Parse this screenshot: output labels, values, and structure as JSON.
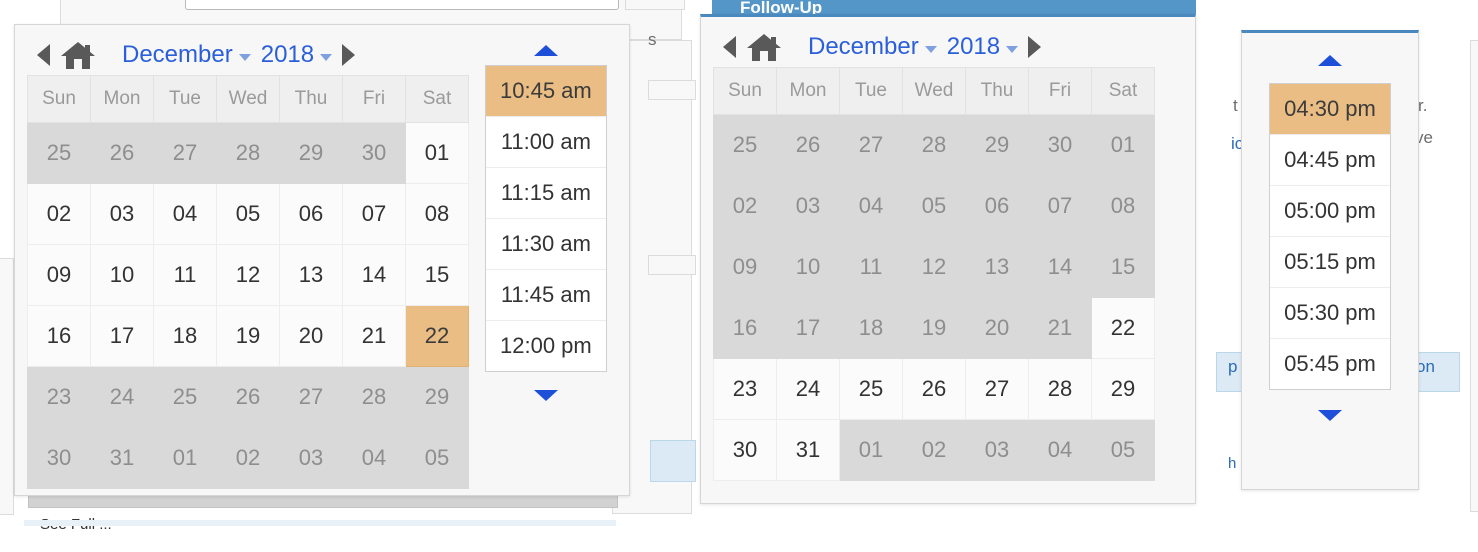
{
  "colors": {
    "selected_amber": "#e9bd83",
    "disabled_grey": "#d9d9d9",
    "link_blue": "#2b5fd9",
    "arrow_blue": "#1e4fd8",
    "accent_blue": "#4a89bd",
    "panel_bg": "#f7f7f7"
  },
  "weekdays": [
    "Sun",
    "Mon",
    "Tue",
    "Wed",
    "Thu",
    "Fri",
    "Sat"
  ],
  "background": {
    "cut_window_title": "Follow-Up",
    "fragment_texts": {
      "left_edge": "s",
      "right_1": "t",
      "right_2": "r.",
      "right_3": "ic",
      "right_4": "ve",
      "blue_left": "p",
      "blue_right": "on",
      "bottom_small": "h",
      "bottom_cut": "See Full ..."
    }
  },
  "picker_one": {
    "name": "start-datetime-picker",
    "header": {
      "prev_label": "previous-month",
      "home_label": "today",
      "month": "December",
      "year": "2018",
      "next_label": "next-month"
    },
    "selected_day": "22",
    "weeks": [
      [
        {
          "d": "25",
          "s": "dim"
        },
        {
          "d": "26",
          "s": "dim"
        },
        {
          "d": "27",
          "s": "dim"
        },
        {
          "d": "28",
          "s": "dim"
        },
        {
          "d": "29",
          "s": "dim"
        },
        {
          "d": "30",
          "s": "dim"
        },
        {
          "d": "01",
          "s": "on"
        }
      ],
      [
        {
          "d": "02",
          "s": "on"
        },
        {
          "d": "03",
          "s": "on"
        },
        {
          "d": "04",
          "s": "on"
        },
        {
          "d": "05",
          "s": "on"
        },
        {
          "d": "06",
          "s": "on"
        },
        {
          "d": "07",
          "s": "on"
        },
        {
          "d": "08",
          "s": "on"
        }
      ],
      [
        {
          "d": "09",
          "s": "on"
        },
        {
          "d": "10",
          "s": "on"
        },
        {
          "d": "11",
          "s": "on"
        },
        {
          "d": "12",
          "s": "on"
        },
        {
          "d": "13",
          "s": "on"
        },
        {
          "d": "14",
          "s": "on"
        },
        {
          "d": "15",
          "s": "on"
        }
      ],
      [
        {
          "d": "16",
          "s": "on"
        },
        {
          "d": "17",
          "s": "on"
        },
        {
          "d": "18",
          "s": "on"
        },
        {
          "d": "19",
          "s": "on"
        },
        {
          "d": "20",
          "s": "on"
        },
        {
          "d": "21",
          "s": "on"
        },
        {
          "d": "22",
          "s": "sel"
        }
      ],
      [
        {
          "d": "23",
          "s": "dim"
        },
        {
          "d": "24",
          "s": "dim"
        },
        {
          "d": "25",
          "s": "dim"
        },
        {
          "d": "26",
          "s": "dim"
        },
        {
          "d": "27",
          "s": "dim"
        },
        {
          "d": "28",
          "s": "dim"
        },
        {
          "d": "29",
          "s": "dim"
        }
      ],
      [
        {
          "d": "30",
          "s": "dim"
        },
        {
          "d": "31",
          "s": "dim"
        },
        {
          "d": "01",
          "s": "dim"
        },
        {
          "d": "02",
          "s": "dim"
        },
        {
          "d": "03",
          "s": "dim"
        },
        {
          "d": "04",
          "s": "dim"
        },
        {
          "d": "05",
          "s": "dim"
        }
      ]
    ],
    "times": {
      "selected": "10:45 am",
      "items": [
        {
          "t": "10:45 am",
          "s": "sel"
        },
        {
          "t": "11:00 am",
          "s": "on"
        },
        {
          "t": "11:15 am",
          "s": "on"
        },
        {
          "t": "11:30 am",
          "s": "on"
        },
        {
          "t": "11:45 am",
          "s": "on"
        },
        {
          "t": "12:00 pm",
          "s": "on"
        }
      ]
    }
  },
  "picker_two": {
    "name": "end-date-picker",
    "header": {
      "prev_label": "previous-month",
      "home_label": "today",
      "month": "December",
      "year": "2018",
      "next_label": "next-month"
    },
    "selected_day": "22",
    "weeks": [
      [
        {
          "d": "25",
          "s": "dim"
        },
        {
          "d": "26",
          "s": "dim"
        },
        {
          "d": "27",
          "s": "dim"
        },
        {
          "d": "28",
          "s": "dim"
        },
        {
          "d": "29",
          "s": "dim"
        },
        {
          "d": "30",
          "s": "dim"
        },
        {
          "d": "01",
          "s": "dim"
        }
      ],
      [
        {
          "d": "02",
          "s": "dim"
        },
        {
          "d": "03",
          "s": "dim"
        },
        {
          "d": "04",
          "s": "dim"
        },
        {
          "d": "05",
          "s": "dim"
        },
        {
          "d": "06",
          "s": "dim"
        },
        {
          "d": "07",
          "s": "dim"
        },
        {
          "d": "08",
          "s": "dim"
        }
      ],
      [
        {
          "d": "09",
          "s": "dim"
        },
        {
          "d": "10",
          "s": "dim"
        },
        {
          "d": "11",
          "s": "dim"
        },
        {
          "d": "12",
          "s": "dim"
        },
        {
          "d": "13",
          "s": "dim"
        },
        {
          "d": "14",
          "s": "dim"
        },
        {
          "d": "15",
          "s": "dim"
        }
      ],
      [
        {
          "d": "16",
          "s": "dim"
        },
        {
          "d": "17",
          "s": "dim"
        },
        {
          "d": "18",
          "s": "dim"
        },
        {
          "d": "19",
          "s": "dim"
        },
        {
          "d": "20",
          "s": "dim"
        },
        {
          "d": "21",
          "s": "dim"
        },
        {
          "d": "22",
          "s": "on"
        }
      ],
      [
        {
          "d": "23",
          "s": "on"
        },
        {
          "d": "24",
          "s": "on"
        },
        {
          "d": "25",
          "s": "on"
        },
        {
          "d": "26",
          "s": "on"
        },
        {
          "d": "27",
          "s": "on"
        },
        {
          "d": "28",
          "s": "on"
        },
        {
          "d": "29",
          "s": "on"
        }
      ],
      [
        {
          "d": "30",
          "s": "on"
        },
        {
          "d": "31",
          "s": "on"
        },
        {
          "d": "01",
          "s": "dim"
        },
        {
          "d": "02",
          "s": "dim"
        },
        {
          "d": "03",
          "s": "dim"
        },
        {
          "d": "04",
          "s": "dim"
        },
        {
          "d": "05",
          "s": "dim"
        }
      ]
    ]
  },
  "picker_three": {
    "name": "end-time-picker",
    "times": {
      "selected": "04:30 pm",
      "items": [
        {
          "t": "04:30 pm",
          "s": "sel"
        },
        {
          "t": "04:45 pm",
          "s": "on"
        },
        {
          "t": "05:00 pm",
          "s": "on"
        },
        {
          "t": "05:15 pm",
          "s": "on"
        },
        {
          "t": "05:30 pm",
          "s": "on"
        },
        {
          "t": "05:45 pm",
          "s": "on"
        }
      ]
    }
  }
}
